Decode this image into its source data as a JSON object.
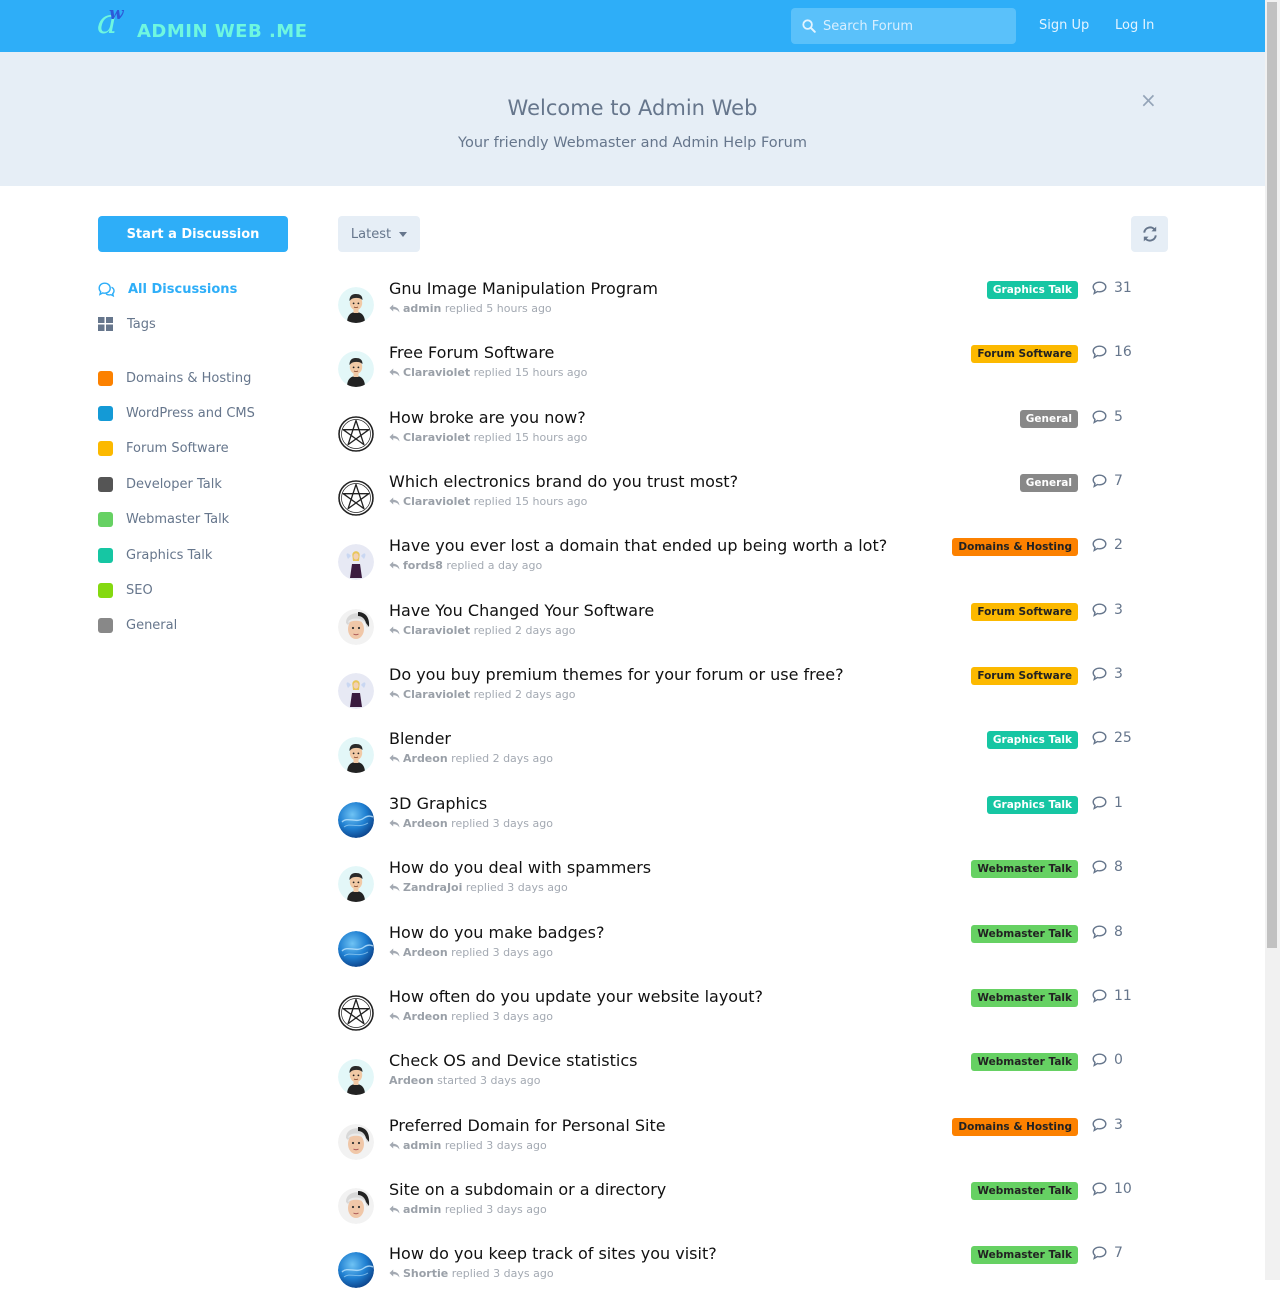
{
  "header": {
    "logo_text": "ADMIN WEB .ME",
    "logo_letter": "a",
    "logo_small_letter": "w",
    "search_placeholder": "Search Forum",
    "sign_up": "Sign Up",
    "log_in": "Log In",
    "bg_color": "#2eaef8"
  },
  "hero": {
    "title": "Welcome to Admin Web",
    "subtitle": "Your friendly Webmaster and Admin Help Forum",
    "close": "×"
  },
  "sidebar": {
    "start_button": "Start a Discussion",
    "nav": [
      {
        "label": "All Discussions",
        "icon": "comments-icon",
        "active": true
      },
      {
        "label": "Tags",
        "icon": "tags-grid-icon",
        "active": false
      }
    ],
    "tags": [
      {
        "label": "Domains & Hosting",
        "color": "#fc8100"
      },
      {
        "label": "WordPress and CMS",
        "color": "#149ad6"
      },
      {
        "label": "Forum Software",
        "color": "#fcb900"
      },
      {
        "label": "Developer Talk",
        "color": "#555555"
      },
      {
        "label": "Webmaster Talk",
        "color": "#66d163"
      },
      {
        "label": "Graphics Talk",
        "color": "#16c6a3"
      },
      {
        "label": "SEO",
        "color": "#84d910"
      },
      {
        "label": "General",
        "color": "#888888"
      }
    ]
  },
  "toolbar": {
    "sort_label": "Latest",
    "refresh_icon": "refresh-icon"
  },
  "discussions": [
    {
      "title": "Gnu Image Manipulation Program",
      "user": "admin",
      "action": "replied",
      "time": "5 hours ago",
      "replied": true,
      "tag": "Graphics Talk",
      "tag_color": "#16c6a3",
      "tag_text_color": "#ffffff",
      "count": "31",
      "avatar": "cartoon-man"
    },
    {
      "title": "Free Forum Software",
      "user": "Claraviolet",
      "action": "replied",
      "time": "15 hours ago",
      "replied": true,
      "tag": "Forum Software",
      "tag_color": "#fcb900",
      "tag_text_color": "#222222",
      "count": "16",
      "avatar": "cartoon-man"
    },
    {
      "title": "How broke are you now?",
      "user": "Claraviolet",
      "action": "replied",
      "time": "15 hours ago",
      "replied": true,
      "tag": "General",
      "tag_color": "#888888",
      "tag_text_color": "#ffffff",
      "count": "5",
      "avatar": "pentagram"
    },
    {
      "title": "Which electronics brand do you trust most?",
      "user": "Claraviolet",
      "action": "replied",
      "time": "15 hours ago",
      "replied": true,
      "tag": "General",
      "tag_color": "#888888",
      "tag_text_color": "#ffffff",
      "count": "7",
      "avatar": "pentagram"
    },
    {
      "title": "Have you ever lost a domain that ended up being worth a lot?",
      "user": "fords8",
      "action": "replied",
      "time": "a day ago",
      "replied": true,
      "tag": "Domains & Hosting",
      "tag_color": "#fc8100",
      "tag_text_color": "#222222",
      "count": "2",
      "avatar": "fairy"
    },
    {
      "title": "Have You Changed Your Software",
      "user": "Claraviolet",
      "action": "replied",
      "time": "2 days ago",
      "replied": true,
      "tag": "Forum Software",
      "tag_color": "#fcb900",
      "tag_text_color": "#222222",
      "count": "3",
      "avatar": "white-hair"
    },
    {
      "title": "Do you buy premium themes for your forum or use free?",
      "user": "Claraviolet",
      "action": "replied",
      "time": "2 days ago",
      "replied": true,
      "tag": "Forum Software",
      "tag_color": "#fcb900",
      "tag_text_color": "#222222",
      "count": "3",
      "avatar": "fairy"
    },
    {
      "title": "Blender",
      "user": "Ardeon",
      "action": "replied",
      "time": "2 days ago",
      "replied": true,
      "tag": "Graphics Talk",
      "tag_color": "#16c6a3",
      "tag_text_color": "#ffffff",
      "count": "25",
      "avatar": "cartoon-man"
    },
    {
      "title": "3D Graphics",
      "user": "Ardeon",
      "action": "replied",
      "time": "3 days ago",
      "replied": true,
      "tag": "Graphics Talk",
      "tag_color": "#16c6a3",
      "tag_text_color": "#ffffff",
      "count": "1",
      "avatar": "ocean"
    },
    {
      "title": "How do you deal with spammers",
      "user": "ZandraJoi",
      "action": "replied",
      "time": "3 days ago",
      "replied": true,
      "tag": "Webmaster Talk",
      "tag_color": "#66d163",
      "tag_text_color": "#222222",
      "count": "8",
      "avatar": "cartoon-man"
    },
    {
      "title": "How do you make badges?",
      "user": "Ardeon",
      "action": "replied",
      "time": "3 days ago",
      "replied": true,
      "tag": "Webmaster Talk",
      "tag_color": "#66d163",
      "tag_text_color": "#222222",
      "count": "8",
      "avatar": "ocean"
    },
    {
      "title": "How often do you update your website layout?",
      "user": "Ardeon",
      "action": "replied",
      "time": "3 days ago",
      "replied": true,
      "tag": "Webmaster Talk",
      "tag_color": "#66d163",
      "tag_text_color": "#222222",
      "count": "11",
      "avatar": "pentagram"
    },
    {
      "title": "Check OS and Device statistics",
      "user": "Ardeon",
      "action": "started",
      "time": "3 days ago",
      "replied": false,
      "tag": "Webmaster Talk",
      "tag_color": "#66d163",
      "tag_text_color": "#222222",
      "count": "0",
      "avatar": "cartoon-man"
    },
    {
      "title": "Preferred Domain for Personal Site",
      "user": "admin",
      "action": "replied",
      "time": "3 days ago",
      "replied": true,
      "tag": "Domains & Hosting",
      "tag_color": "#fc8100",
      "tag_text_color": "#222222",
      "count": "3",
      "avatar": "white-hair"
    },
    {
      "title": "Site on a subdomain or a directory",
      "user": "admin",
      "action": "replied",
      "time": "3 days ago",
      "replied": true,
      "tag": "Webmaster Talk",
      "tag_color": "#66d163",
      "tag_text_color": "#222222",
      "count": "10",
      "avatar": "white-hair"
    },
    {
      "title": "How do you keep track of sites you visit?",
      "user": "Shortie",
      "action": "replied",
      "time": "3 days ago",
      "replied": true,
      "tag": "Webmaster Talk",
      "tag_color": "#66d163",
      "tag_text_color": "#222222",
      "count": "7",
      "avatar": "ocean"
    }
  ]
}
